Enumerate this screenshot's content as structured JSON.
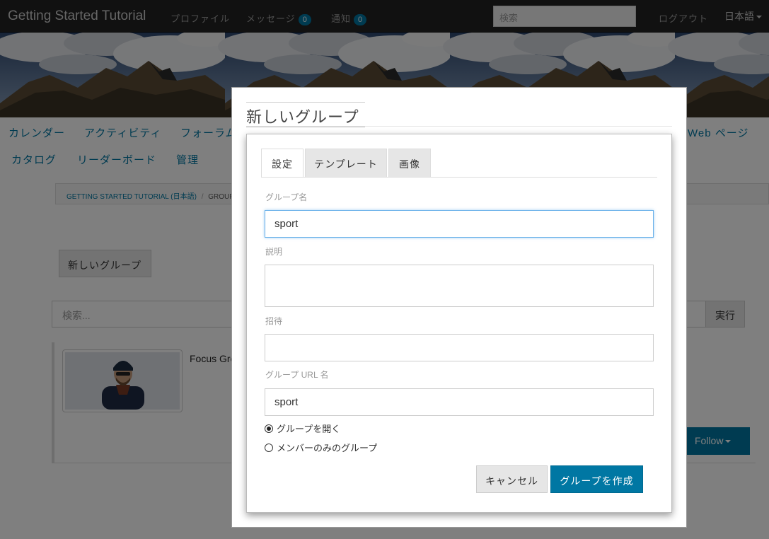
{
  "navbar": {
    "brand": "Getting Started Tutorial",
    "profile": "プロファイル",
    "messages": "メッセージ",
    "messages_count": "0",
    "notifications": "通知",
    "notifications_count": "0",
    "search_placeholder": "検索",
    "logout": "ログアウト",
    "language": "日本語"
  },
  "page_nav": {
    "row1": [
      "カレンダー",
      "アクティビティ",
      "フォーラム",
      "Web ページ"
    ],
    "row2": [
      "カタログ",
      "リーダーボード",
      "管理"
    ]
  },
  "breadcrumb": {
    "root": "GETTING STARTED TUTORIAL (日本語)",
    "separator": "/",
    "current": "GROUPS"
  },
  "groups_page": {
    "new_group_button": "新しいグループ",
    "search_placeholder": "検索...",
    "search_button": "実行",
    "card_title": "Focus Gro",
    "follow_button": "Follow"
  },
  "modal": {
    "title": "新しいグループ",
    "tabs": [
      "設定",
      "テンプレート",
      "画像"
    ],
    "active_tab": "設定",
    "group_name_label": "グループ名",
    "group_name_value": "sport",
    "description_label": "説明",
    "description_value": "",
    "invite_label": "招待",
    "invite_value": "",
    "url_name_label": "グループ URL 名",
    "url_name_value": "sport",
    "radio_open": "グループを開く",
    "radio_members": "メンバーのみのグループ",
    "cancel_button": "キャンセル",
    "create_button": "グループを作成"
  },
  "colors": {
    "navbar_bg": "#222222",
    "accent": "#0077a3",
    "badge": "#0077a3"
  }
}
